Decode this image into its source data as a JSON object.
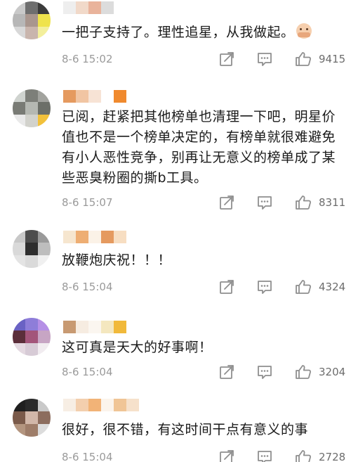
{
  "comments": [
    {
      "text": "一把子支持了。理性追星，从我做起。",
      "emoji_icon": "hands-together-emoji",
      "time": "8-6 15:02",
      "likes": "9415",
      "avatar_colors": [
        "#c9c9c9",
        "#6e6e6e",
        "#3b3b3b",
        "#b7b7b7",
        "#a9968e",
        "#efe34c",
        "#d8d8d8",
        "#c9b5ad",
        "#f3ef9c"
      ],
      "name_colors": [
        "#eeeeee",
        "#f1d9c9",
        "#e9b39b",
        "#dcdcdc"
      ]
    },
    {
      "text": "已阅，赶紧把其他榜单也清理一下吧，明星价值也不是一个榜单决定的，有榜单就很难避免有小人恶性竞争，别再让无意义的榜单成了某些恶臭粉圈的撕b工具。",
      "time": "8-6 15:07",
      "likes": "8311",
      "avatar_colors": [
        "#cfd3cf",
        "#7d7f79",
        "#a2a39e",
        "#797b75",
        "#b5b8b2",
        "#6c6f68",
        "#e9e9e9",
        "#d2d2cc",
        "#f2c13b"
      ],
      "name_colors": [
        "#e59a5f",
        "#f1c5a3",
        "#f7e3d5",
        "#ffffff",
        "#f08a2e"
      ]
    },
    {
      "text": "放鞭炮庆祝！！！",
      "time": "8-6 15:04",
      "likes": "4324",
      "avatar_colors": [
        "#c8c8c8",
        "#4d4d4d",
        "#9a9a9a",
        "#d9d9d9",
        "#2e2e2e",
        "#bdbdbd",
        "#e4e4e4",
        "#dadada",
        "#f0f0f0"
      ],
      "name_colors": [
        "#f6e6cf",
        "#eeae73",
        "#fbf2e7",
        "#e59a5f",
        "#f7dec2"
      ]
    },
    {
      "text": "这可真是天大的好事啊！",
      "time": "8-6 15:04",
      "likes": "3204",
      "avatar_colors": [
        "#6a62c4",
        "#8e7dd9",
        "#b58fe6",
        "#5b2e3a",
        "#a3557a",
        "#c7a5c4",
        "#e4d9e1",
        "#d7cbd6",
        "#f1ecf0"
      ],
      "name_colors": [
        "#c89a72",
        "#f6ece1",
        "#fbf6f0",
        "#f4e7bf",
        "#f1b93a"
      ]
    },
    {
      "text": "很好，很不错，有这时间干点有意义的事",
      "time": "8-6 15:04",
      "likes": "2728",
      "avatar_colors": [
        "#1f1f1f",
        "#2a2a2a",
        "#c9c9c9",
        "#7a5a4a",
        "#d1b7a9",
        "#8c6d5e",
        "#b3957f",
        "#9e7d69",
        "#dcdcdc"
      ],
      "name_colors": [
        "#f7eee4",
        "#f3cfae",
        "#f2b377",
        "#fbf4ec",
        "#f0c596",
        "#f6e1cb"
      ]
    }
  ]
}
